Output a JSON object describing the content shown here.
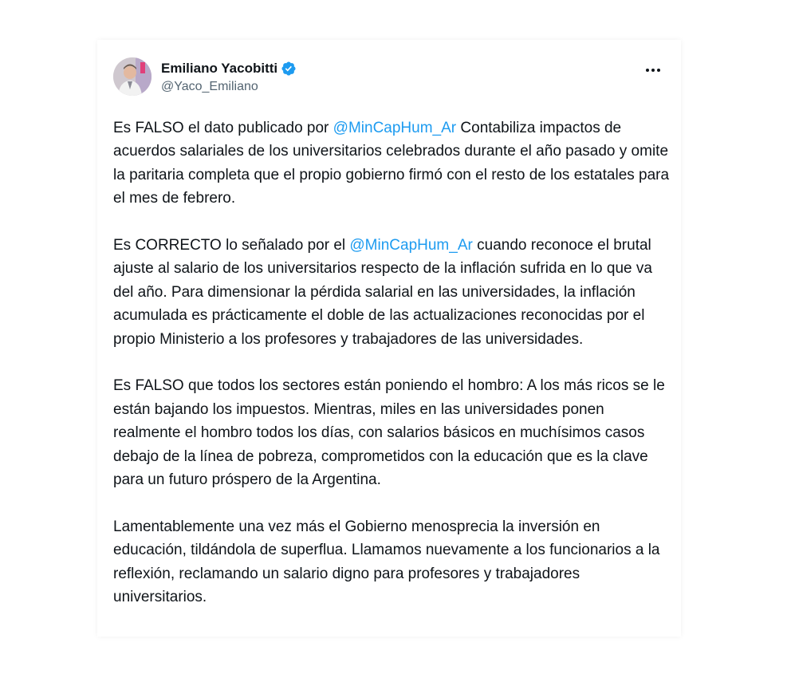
{
  "author": {
    "display_name": "Emiliano Yacobitti",
    "handle": "@Yaco_Emiliano",
    "verified_icon": "verified-badge-icon",
    "avatar_icon": "avatar"
  },
  "menu": {
    "icon": "more-options-icon"
  },
  "colors": {
    "text": "#0f1419",
    "secondary_text": "#536471",
    "mention": "#1d9bf0",
    "verified": "#1d9bf0"
  },
  "tweet": {
    "p1": {
      "t1": "Es FALSO el dato publicado por ",
      "mention": "@MinCapHum_Ar",
      "t2": " Contabiliza impactos de acuerdos salariales de los universitarios celebrados durante el año pasado y omite la paritaria completa que el propio gobierno firmó con el resto de los estatales para el mes de febrero."
    },
    "p2": {
      "t1": "Es CORRECTO lo señalado por el ",
      "mention": "@MinCapHum_Ar",
      "t2": " cuando reconoce el brutal ajuste al salario de los universitarios respecto de la inflación sufrida en lo que va del año. Para dimensionar la pérdida salarial en las universidades, la inflación acumulada es prácticamente el doble de las actualizaciones reconocidas por el propio Ministerio a los profesores y trabajadores de las universidades."
    },
    "p3": "Es FALSO que todos los sectores están poniendo el hombro: A los más ricos se le están bajando los impuestos. Mientras, miles en las universidades ponen realmente el hombro todos los días, con salarios básicos en muchísimos casos debajo de la línea de pobreza, comprometidos con la educación que es la clave para un futuro próspero de la Argentina.",
    "p4": "Lamentablemente una vez más el Gobierno menosprecia la inversión en educación, tildándola de superflua. Llamamos nuevamente a los funcionarios a la reflexión, reclamando un salario digno para profesores y trabajadores universitarios."
  }
}
